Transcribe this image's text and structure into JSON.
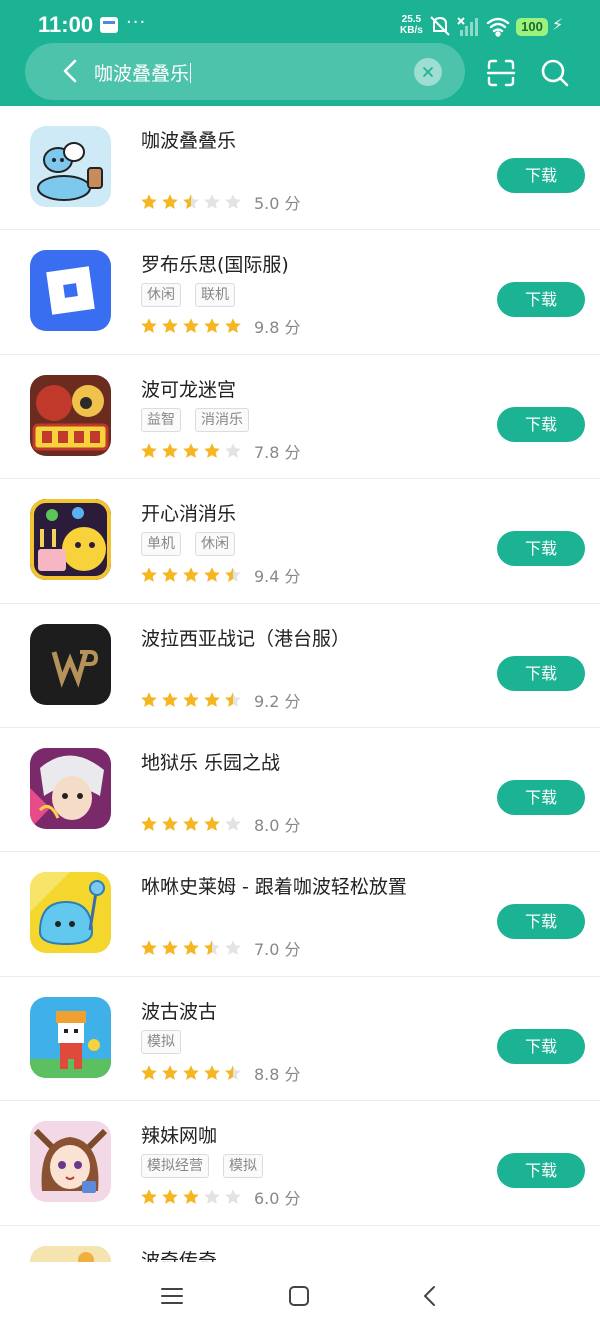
{
  "status_bar": {
    "time": "11:00",
    "more": "···",
    "net_speed_value": "25.5",
    "net_speed_unit": "KB/s",
    "battery": "100",
    "icons": [
      "notification-app-icon",
      "mute-icon",
      "no-sim-icon",
      "signal-icon",
      "wifi-icon",
      "battery-icon",
      "charging-icon"
    ]
  },
  "search": {
    "query": "咖波叠叠乐",
    "icons": [
      "back-icon",
      "clear-icon",
      "scan-icon",
      "search-icon"
    ]
  },
  "colors": {
    "accent": "#1bb394",
    "star_filled": "#f5b622",
    "star_empty": "#e3e3e3",
    "text_primary": "#222222",
    "text_secondary": "#888888"
  },
  "results": [
    {
      "name": "咖波叠叠乐",
      "tags": [],
      "rating": 2.5,
      "score": "5.0 分",
      "button": "下载",
      "icon": "bugcat-capoo-icon"
    },
    {
      "name": "罗布乐思(国际服)",
      "tags": [
        "休闲",
        "联机"
      ],
      "rating": 5,
      "score": "9.8 分",
      "button": "下载",
      "icon": "roblox-icon"
    },
    {
      "name": "波可龙迷宫",
      "tags": [
        "益智",
        "消消乐"
      ],
      "rating": 4,
      "score": "7.8 分",
      "button": "下载",
      "icon": "puzzle-dragons-icon"
    },
    {
      "name": "开心消消乐",
      "tags": [
        "单机",
        "休闲"
      ],
      "rating": 4.5,
      "score": "9.4 分",
      "button": "下载",
      "icon": "happy-elements-icon"
    },
    {
      "name": "波拉西亚战记（港台服）",
      "tags": [],
      "rating": 4.5,
      "score": "9.2 分",
      "button": "下载",
      "icon": "wp-logo-icon"
    },
    {
      "name": "地狱乐 乐园之战",
      "tags": [],
      "rating": 4,
      "score": "8.0 分",
      "button": "下载",
      "icon": "anime-character-icon"
    },
    {
      "name": "咻咻史莱姆 - 跟着咖波轻松放置",
      "tags": [],
      "rating": 3.5,
      "score": "7.0 分",
      "button": "下载",
      "icon": "slime-icon"
    },
    {
      "name": "波古波古",
      "tags": [
        "模拟"
      ],
      "rating": 4.5,
      "score": "8.8 分",
      "button": "下载",
      "icon": "pixel-worker-icon"
    },
    {
      "name": "辣妹网咖",
      "tags": [
        "模拟经营",
        "模拟"
      ],
      "rating": 3,
      "score": "6.0 分",
      "button": "下载",
      "icon": "anime-girl-icon"
    },
    {
      "name": "波奇传奇",
      "tags": [],
      "rating": null,
      "score": "",
      "button": "",
      "icon": "partial-app-icon"
    }
  ],
  "nav_bar": {
    "icons": [
      "menu-icon",
      "home-icon",
      "back-nav-icon"
    ]
  }
}
